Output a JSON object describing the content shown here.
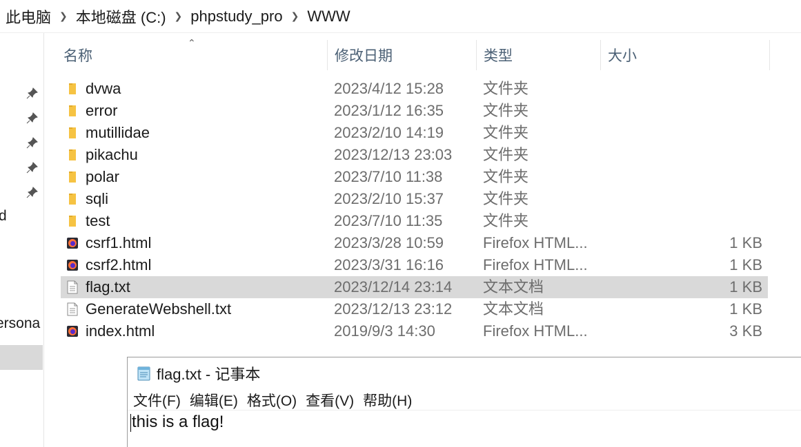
{
  "breadcrumb": [
    "此电脑",
    "本地磁盘 (C:)",
    "phpstudy_pro",
    "WWW"
  ],
  "nav_pane": {
    "partial_labels": [
      "d",
      "ersona"
    ]
  },
  "columns": {
    "name": "名称",
    "date": "修改日期",
    "type": "类型",
    "size": "大小"
  },
  "files": [
    {
      "name": "dvwa",
      "date": "2023/4/12 15:28",
      "type": "文件夹",
      "size": "",
      "icon": "folder-icon"
    },
    {
      "name": "error",
      "date": "2023/1/12 16:35",
      "type": "文件夹",
      "size": "",
      "icon": "folder-icon"
    },
    {
      "name": "mutillidae",
      "date": "2023/2/10 14:19",
      "type": "文件夹",
      "size": "",
      "icon": "folder-icon"
    },
    {
      "name": "pikachu",
      "date": "2023/12/13 23:03",
      "type": "文件夹",
      "size": "",
      "icon": "folder-icon"
    },
    {
      "name": "polar",
      "date": "2023/7/10 11:38",
      "type": "文件夹",
      "size": "",
      "icon": "folder-icon"
    },
    {
      "name": "sqli",
      "date": "2023/2/10 15:37",
      "type": "文件夹",
      "size": "",
      "icon": "folder-icon"
    },
    {
      "name": "test",
      "date": "2023/7/10 11:35",
      "type": "文件夹",
      "size": "",
      "icon": "folder-icon"
    },
    {
      "name": "csrf1.html",
      "date": "2023/3/28 10:59",
      "type": "Firefox HTML...",
      "size": "1 KB",
      "icon": "firefox-html-icon"
    },
    {
      "name": "csrf2.html",
      "date": "2023/3/31 16:16",
      "type": "Firefox HTML...",
      "size": "1 KB",
      "icon": "firefox-html-icon"
    },
    {
      "name": "flag.txt",
      "date": "2023/12/14 23:14",
      "type": "文本文档",
      "size": "1 KB",
      "icon": "text-file-icon",
      "selected": true
    },
    {
      "name": "GenerateWebshell.txt",
      "date": "2023/12/13 23:12",
      "type": "文本文档",
      "size": "1 KB",
      "icon": "text-file-icon"
    },
    {
      "name": "index.html",
      "date": "2019/9/3 14:30",
      "type": "Firefox HTML...",
      "size": "3 KB",
      "icon": "firefox-html-icon"
    }
  ],
  "notepad": {
    "title": "flag.txt - 记事本",
    "menu": [
      "文件(F)",
      "编辑(E)",
      "格式(O)",
      "查看(V)",
      "帮助(H)"
    ],
    "content": "this is a flag!"
  },
  "colors": {
    "folder": "#f6c343",
    "selection": "#d9d9d9",
    "header_text": "#4b6075",
    "secondary_text": "#6d6d6d",
    "firefox_purple": "#592acb",
    "firefox_orange": "#ff7139"
  }
}
